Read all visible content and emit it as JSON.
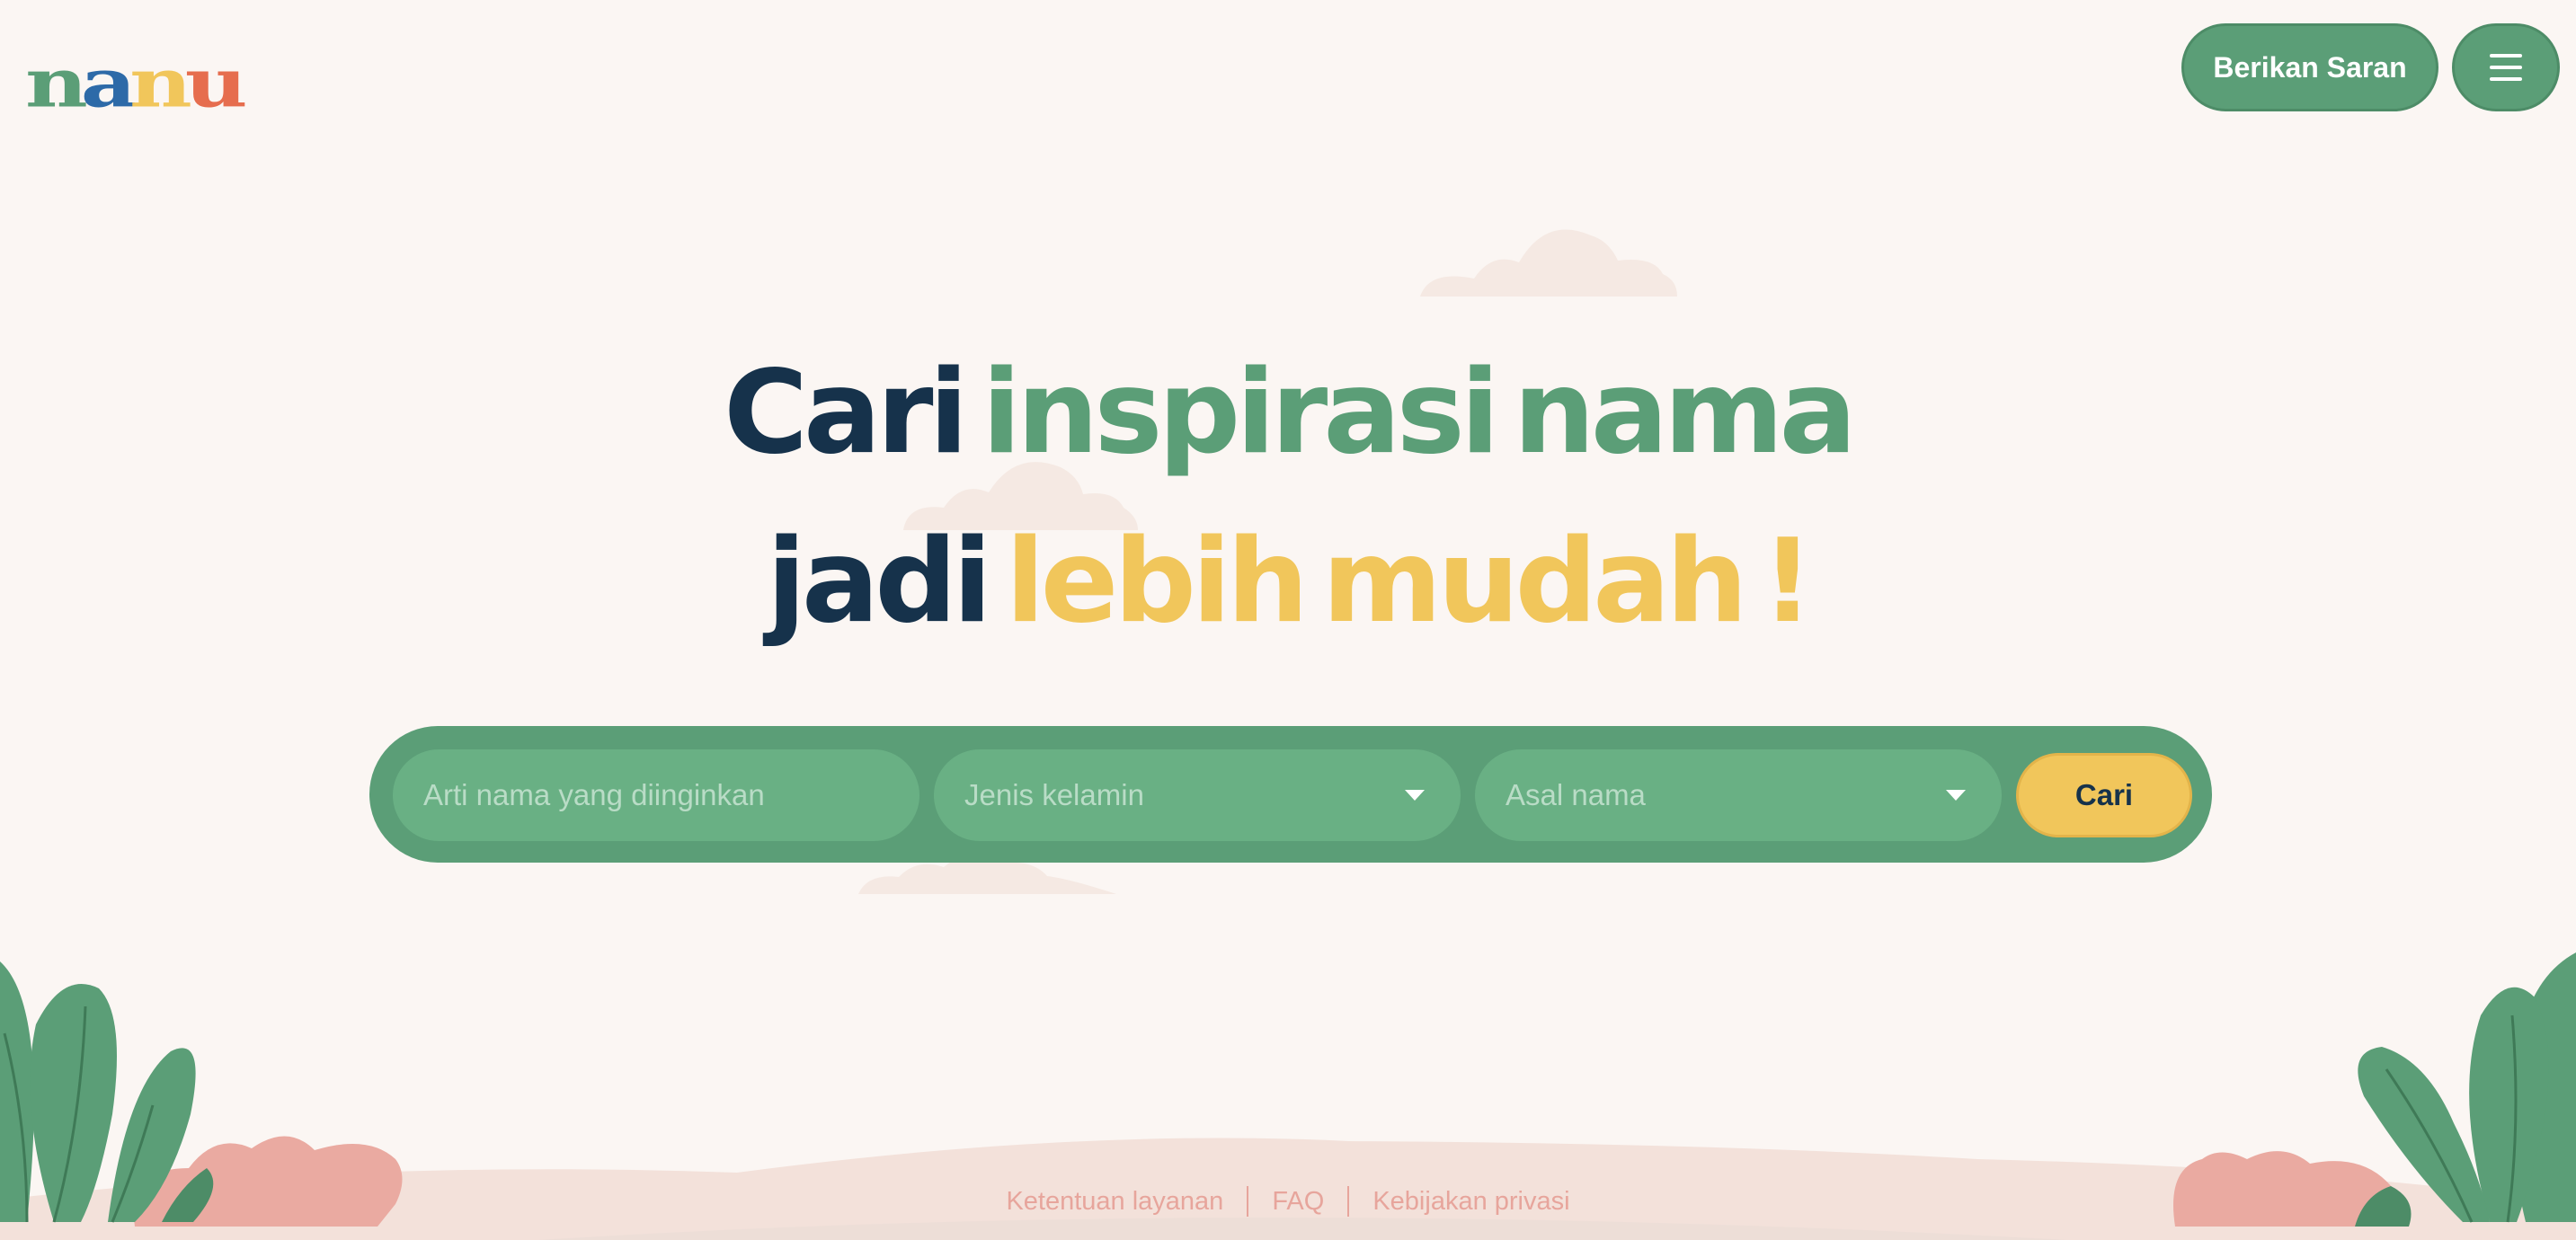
{
  "logo": {
    "letters": [
      "n",
      "a",
      "n",
      "u"
    ],
    "colors": [
      "#5b9e77",
      "#2d6aa8",
      "#f1c65b",
      "#e66d4e"
    ]
  },
  "header": {
    "suggest_label": "Berikan Saran",
    "menu_icon": "hamburger-icon"
  },
  "hero": {
    "line1": [
      {
        "text": "Cari",
        "color": "#16324b"
      },
      {
        "text": "inspirasi",
        "color": "#5b9e77"
      },
      {
        "text": "nama",
        "color": "#5b9e77"
      }
    ],
    "line2": [
      {
        "text": "jadi",
        "color": "#16324b"
      },
      {
        "text": "lebih",
        "color": "#f1c65b"
      },
      {
        "text": "mudah",
        "color": "#f1c65b"
      },
      {
        "text": "!",
        "color": "#f1c65b"
      }
    ]
  },
  "search": {
    "meaning_placeholder": "Arti nama yang diinginkan",
    "gender_placeholder": "Jenis kelamin",
    "origin_placeholder": "Asal nama",
    "submit_label": "Cari"
  },
  "footer": {
    "links": [
      "Ketentuan layanan",
      "FAQ",
      "Kebijakan privasi"
    ]
  },
  "colors": {
    "background": "#fbf6f3",
    "green": "#5b9e77",
    "yellow": "#f1c65b",
    "navy": "#16324b",
    "pink": "#e7a59c"
  }
}
